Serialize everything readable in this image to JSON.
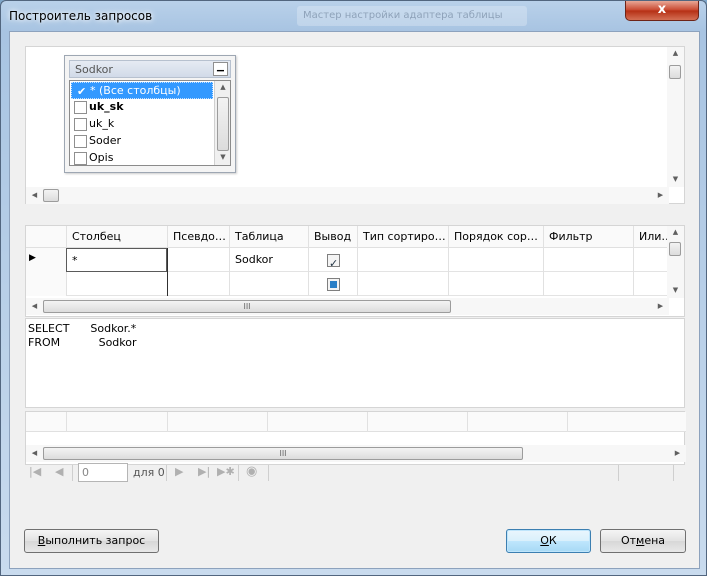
{
  "window": {
    "title": "Построитель запросов",
    "bg_title": "Мастер настройки адаптера таблицы",
    "close_glyph": "x"
  },
  "diagram": {
    "table": {
      "name": "Sodkor",
      "min_glyph": "▁",
      "columns": [
        {
          "label": "* (Все столбцы)",
          "checked": true,
          "selected": true,
          "bold": false
        },
        {
          "label": "uk_sk",
          "checked": false,
          "selected": false,
          "bold": true
        },
        {
          "label": "uk_k",
          "checked": false,
          "selected": false,
          "bold": false
        },
        {
          "label": "Soder",
          "checked": false,
          "selected": false,
          "bold": false
        },
        {
          "label": "Opis",
          "checked": false,
          "selected": false,
          "bold": false
        }
      ]
    }
  },
  "grid": {
    "headers": [
      "Столбец",
      "Псевдо…",
      "Таблица",
      "Вывод",
      "Тип сортиро…",
      "Порядок сор…",
      "Фильтр",
      "Или…"
    ],
    "rows": [
      {
        "column": "*",
        "alias": "",
        "table": "Sodkor",
        "output": "checked"
      },
      {
        "column": "",
        "alias": "",
        "table": "",
        "output": "indeterminate"
      }
    ],
    "hscroll_grip": "III"
  },
  "sql": {
    "lines": [
      "SELECT      Sodkor.*",
      "FROM           Sodkor"
    ]
  },
  "results": {
    "hscroll_grip": "III"
  },
  "navigator": {
    "first_glyph": "|◀",
    "prev_glyph": "◀",
    "position_value": "0",
    "of_label": "для 0",
    "next_glyph": "▶",
    "last_glyph": "▶|",
    "new_glyph": "▶✱",
    "stop_glyph": "◉"
  },
  "buttons": {
    "execute_underlined": "В",
    "execute_rest": "ыполнить запрос",
    "ok_underlined": "О",
    "ok_rest": "К",
    "cancel_prefix": "От",
    "cancel_underlined": "м",
    "cancel_rest": "ена"
  }
}
